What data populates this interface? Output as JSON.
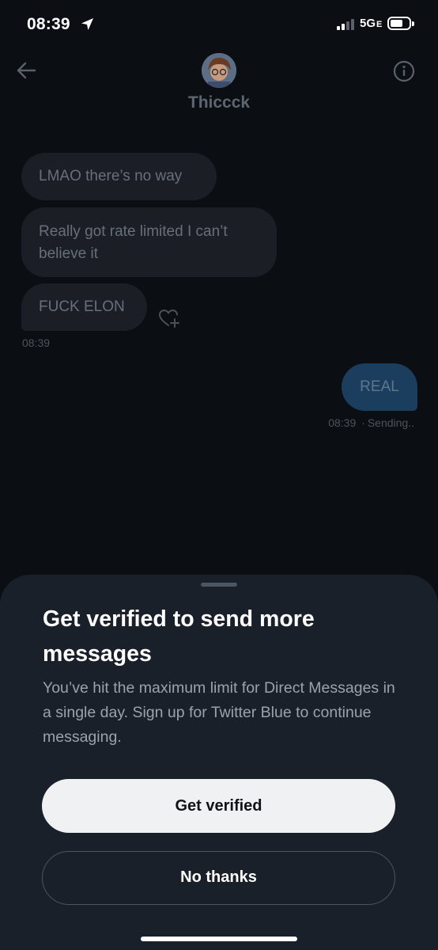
{
  "status_bar": {
    "time": "08:39",
    "network": "5G",
    "network_suffix": "E",
    "battery_level": 0.7,
    "signal_bars": 2
  },
  "header": {
    "contact_name": "Thiccck",
    "back_icon": "arrow-left-icon",
    "info_icon": "info-circle-icon"
  },
  "messages": {
    "received": [
      {
        "text": "LMAO there’s no way"
      },
      {
        "text": "Really got rate limited I can’t believe it"
      },
      {
        "text": "FUCK ELON"
      }
    ],
    "received_time": "08:39",
    "sent": {
      "text": "REAL",
      "time": "08:39",
      "status": "Sending.."
    }
  },
  "sheet": {
    "title": "Get verified to send more messages",
    "description": "You’ve hit the maximum limit for Direct Messages in a single day. Sign up for Twitter Blue to continue messaging.",
    "primary_label": "Get verified",
    "secondary_label": "No thanks"
  },
  "colors": {
    "sheet_bg": "#1a2029",
    "primary_button": "#eff1f2",
    "sent_bubble": "#1c3e5e"
  }
}
